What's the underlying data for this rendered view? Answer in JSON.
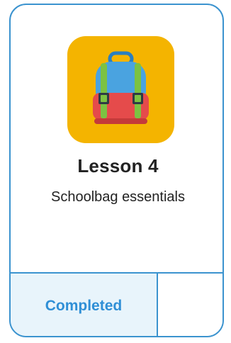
{
  "card": {
    "icon": "backpack-icon",
    "title": "Lesson 4",
    "subtitle": "Schoolbag essentials",
    "status_label": "Completed"
  },
  "colors": {
    "border": "#3b93cf",
    "icon_tile": "#f4b400",
    "status_bg": "#e8f4fb",
    "status_text": "#2f8fd6"
  }
}
